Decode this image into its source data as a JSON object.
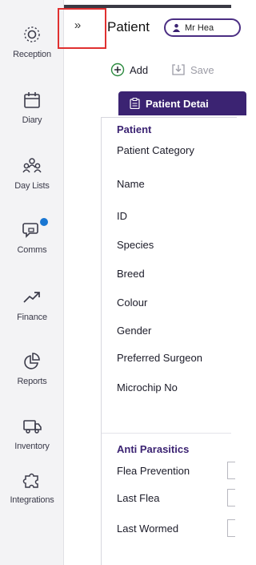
{
  "sidebar": {
    "items": [
      {
        "label": "Reception",
        "icon": "reception-icon"
      },
      {
        "label": "Diary",
        "icon": "calendar-icon"
      },
      {
        "label": "Day Lists",
        "icon": "people-icon"
      },
      {
        "label": "Comms",
        "icon": "chat-icon",
        "has_notification": true
      },
      {
        "label": "Finance",
        "icon": "trend-arrow-icon"
      },
      {
        "label": "Reports",
        "icon": "pie-chart-icon"
      },
      {
        "label": "Inventory",
        "icon": "truck-icon"
      },
      {
        "label": "Integrations",
        "icon": "puzzle-icon"
      }
    ]
  },
  "header": {
    "collapse_label": "»",
    "title": "Patient",
    "client_pill": "Mr Hea"
  },
  "toolbar": {
    "add_label": "Add",
    "save_label": "Save"
  },
  "tab": {
    "label": "Patient Detai"
  },
  "patient_section": {
    "heading": "Patient",
    "fields": [
      "Patient Category",
      "Name",
      "ID",
      "Species",
      "Breed",
      "Colour",
      "Gender",
      "Preferred Surgeon",
      "Microchip No"
    ]
  },
  "anti_parasitics_section": {
    "heading": "Anti Parasitics",
    "fields": [
      "Flea Prevention",
      "Last Flea",
      "Last Wormed"
    ]
  },
  "colors": {
    "accent": "#3b2372",
    "notification": "#1976d2",
    "highlight": "#e03030"
  }
}
